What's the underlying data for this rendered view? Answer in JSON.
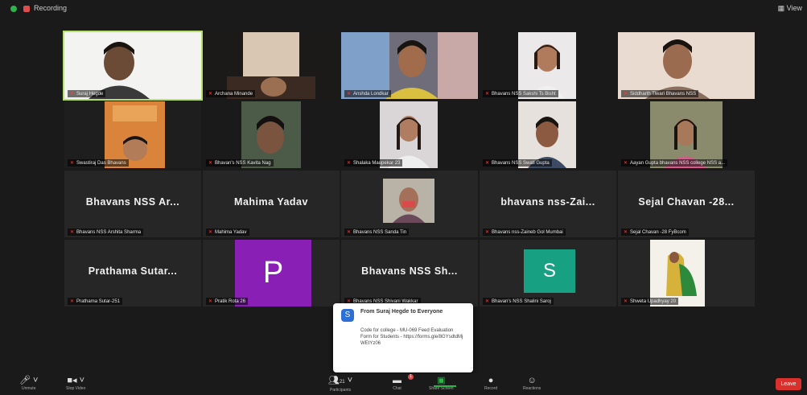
{
  "topbar": {
    "recording_label": "Recording",
    "view_label": "View"
  },
  "row1": {
    "t1": "Suraj Hegde",
    "t2": "Archana Minande",
    "t3": "Anshda Londkar",
    "t4": "Bhavans NSS Sakshi Ts Bisht",
    "t5": "Siddharth Tiwari Bhavans NSS"
  },
  "row2": {
    "t1": "Swastiraj Das Bhavans",
    "t2": "Bhavan's NSS Kavita Nag",
    "t3": "Shalaka Maupekar 23",
    "t4": "Bhavans NSS Swati Gupta",
    "t5": "Aayan Gupta bhavans NSS college NSS a..."
  },
  "row3": {
    "t1_name": "Bhavans NSS Ar...",
    "t1_cap": "Bhavans NSS Arshita Sharma",
    "t2_name": "Mahima Yadav",
    "t2_cap": "Mahima Yadav",
    "t3_cap": "Bhavans NSS Sanda Tin",
    "t4_name": "bhavans nss-Zai...",
    "t4_cap": "Bhavans nss-Zaineb Gol Mumbai",
    "t5_name": "Sejal Chavan -28...",
    "t5_cap": "Sejal Chavan -28 FyBcom"
  },
  "row4": {
    "t1_name": "Prathama Sutar...",
    "t1_cap": "Prathama Sutar-251",
    "t2_letter": "P",
    "t2_cap": "Pratik Rota 26",
    "t3_name": "Bhavans NSS Sh...",
    "t3_cap": "Bhavans NSS Shivani Wakkar",
    "t4_letter": "S",
    "t4_cap": "Bhavan's NSS Shalini Saroj",
    "t5_cap": "Shweta Upadhyay 20"
  },
  "chat": {
    "icon_letter": "S",
    "from": "From Suraj Hegde to Everyone",
    "message": "Code for college - MU-069 Feed Evaluation Form for Students - https://forms.gle/8GYsdtdMj WEtYz06"
  },
  "bottombar": {
    "unmute": "Unmute",
    "stop_video": "Stop Video",
    "participants": "Participants",
    "participants_count": "21",
    "chat": "Chat",
    "chat_badge": "1",
    "share_screen": "Share Screen",
    "record": "Record",
    "reactions": "Reactions",
    "leave": "Leave"
  }
}
